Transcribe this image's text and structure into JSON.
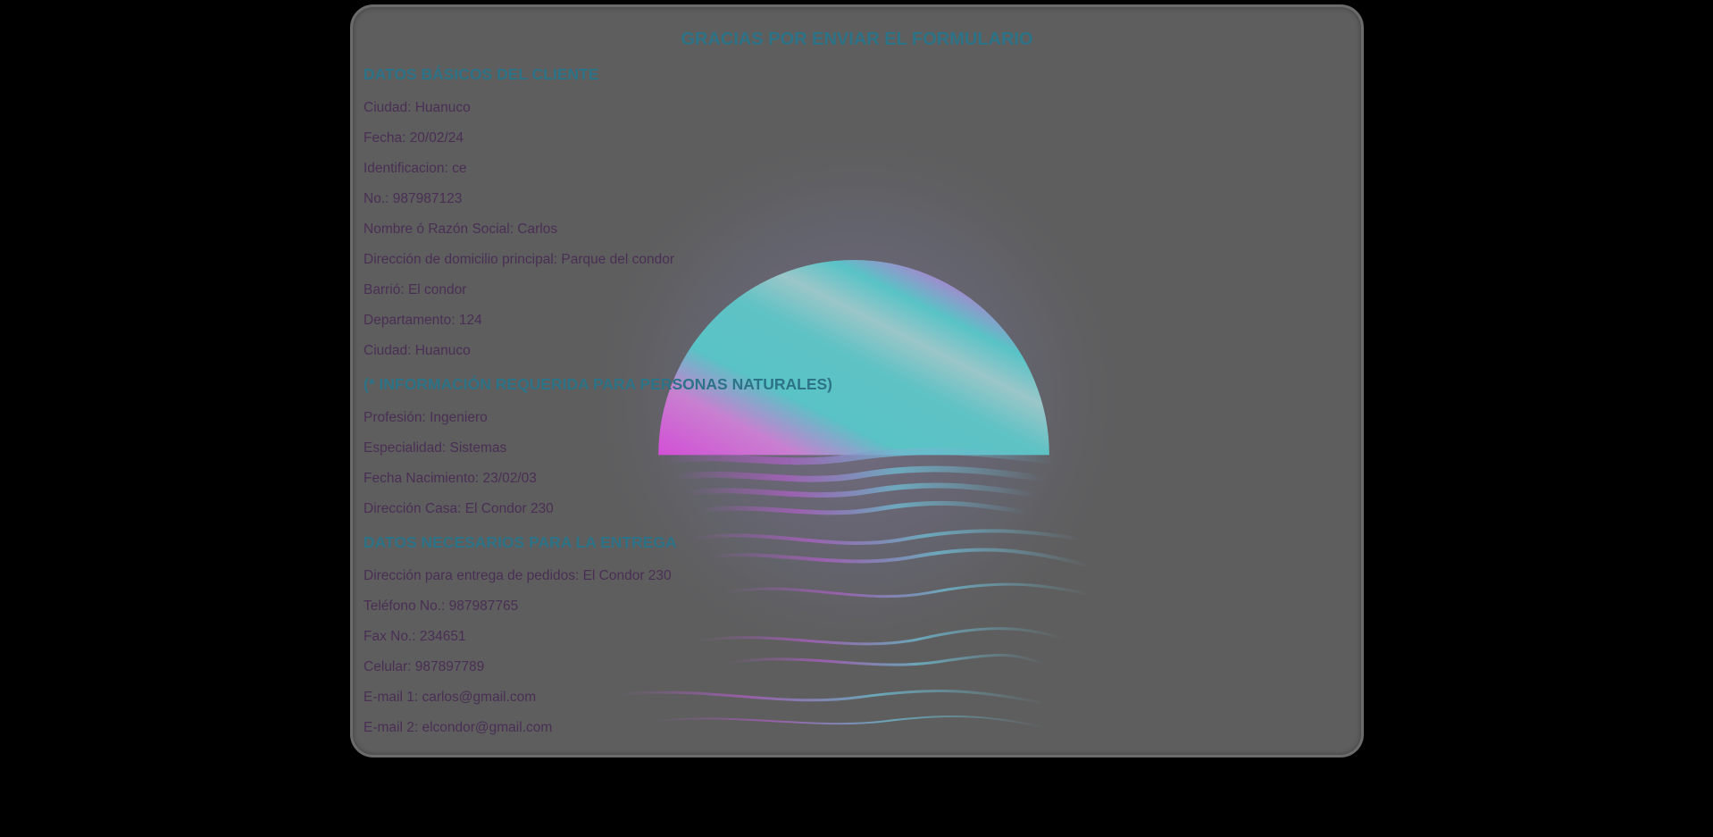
{
  "title": "GRACIAS POR ENVIAR EL FORMULARIO",
  "sections": {
    "basic": {
      "heading": "DATOS BÁSICOS DEL CLIENTE",
      "lines": [
        "Ciudad: Huanuco",
        "Fecha: 20/02/24",
        "Identificacion: ce",
        "No.: 987987123",
        "Nombre ó Razón Social: Carlos",
        "Dirección de domicilio principal: Parque del condor",
        "Barrió: El condor",
        "Departamento: 124",
        "Ciudad: Huanuco"
      ]
    },
    "natural": {
      "heading": "(* INFORMACIÓN REQUERIDA PARA PERSONAS NATURALES)",
      "lines": [
        "Profesión: Ingeniero",
        "Especialidad: Sistemas",
        "Fecha Nacimiento: 23/02/03",
        "Dirección Casa: El Condor 230"
      ]
    },
    "delivery": {
      "heading": "DATOS NECESARIOS PARA LA ENTREGA",
      "lines": [
        "Dirección para entrega de pedidos: El Condor 230",
        "Teléfono No.: 987987765",
        "Fax No.: 234651",
        "Celular: 987897789",
        "E-mail 1: carlos@gmail.com",
        "E-mail 2: elcondor@gmail.com"
      ]
    }
  },
  "colors": {
    "page_background": "#000000",
    "card_background": "#5e5e5e",
    "heading_color": "#2c7387",
    "text_color": "#4a2f55",
    "sun_pink": "#d24fd6",
    "sun_teal": "#59c3c6"
  },
  "background_image": "sunset-over-water"
}
